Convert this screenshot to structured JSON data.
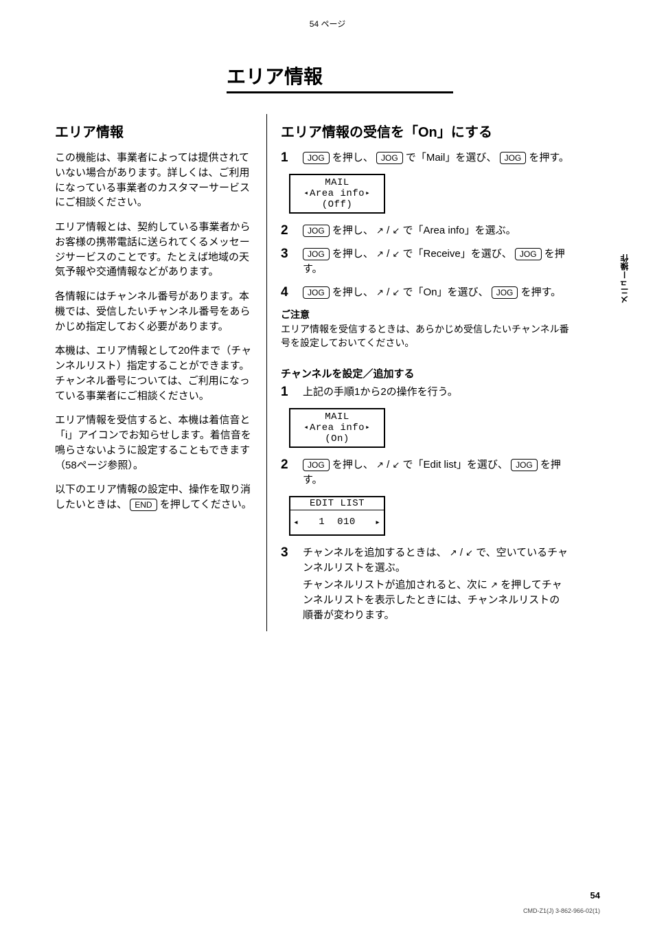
{
  "topPageMarker": "54 ページ",
  "title": "エリア情報",
  "section": {
    "leftHeading": "エリア情報",
    "intro1": "この機能は、事業者によっては提供されていない場合があります。詳しくは、ご利用になっている事業者のカスタマーサービスにご相談ください。",
    "intro2": "エリア情報とは、契約している事業者からお客様の携帯電話に送られてくるメッセージサービスのことです。たとえば地域の天気予報や交通情報などがあります。",
    "intro3": "各情報にはチャンネル番号があります。本機では、受信したいチャンネル番号をあらかじめ指定しておく必要があります。",
    "intro4": "本機は、エリア情報として20件まで（チャンネルリスト）指定することができます。チャンネル番号については、ご利用になっている事業者にご相談ください。",
    "intro5": "エリア情報を受信すると、本機は着信音と「i」アイコンでお知らせします。着信音を鳴らさないように設定することもできます（58ページ参照）。",
    "cancelNote": "以下のエリア情報の設定中、操作を取り消したいときは、",
    "cancelNote2": "を押してください。"
  },
  "right": {
    "heading": "エリア情報の受信を「On」にする",
    "step1_lead": "を押し、",
    "step1_lead2": "で「Mail」を選び、",
    "step1_lead3": "を押す。",
    "step2_a": "を押し、",
    "step2_b": "/",
    "step2_c": "で「Area info」を選ぶ。",
    "step3_a": "を押し、",
    "step3_b": "/",
    "step3_c": "で「Receive」を選び、",
    "step3_d": "を押す。",
    "step4_a": "を押し、",
    "step4_b": "/",
    "step4_c": "で「On」を選び、",
    "step4_d": "を押す。",
    "noteTitle": "ご注意",
    "noteBody": "エリア情報を受信するときは、あらかじめ受信したいチャンネル番号を設定しておいてください。",
    "sub2": "チャンネルを設定／追加する",
    "sub2_p1a": "上記の手順1から2の操作を行う。",
    "sub2_2a": "を押し、",
    "sub2_2b": "/",
    "sub2_2c": "で「Edit list」を選び、",
    "sub2_2d": "を押す。",
    "sub2_3a": "チャンネルを追加するときは、",
    "sub2_3b": "/",
    "sub2_3c": "で、空いているチャンネルリストを選ぶ。",
    "sub2_3d": "チャンネルリストが追加されると、次に",
    "sub2_3e": "を押してチャンネルリストを表示したときには、チャンネルリストの順番が変わります。"
  },
  "lcd1": {
    "l1": "MAIL",
    "l2": "Area info",
    "l3": "(Off)"
  },
  "lcd2": {
    "l1": "MAIL",
    "l2": "Area info",
    "l3": "(On)"
  },
  "lcd3": {
    "title": "EDIT LIST",
    "idx": "1",
    "val": "010"
  },
  "jogLabel": "JOG",
  "vertical": "メニュー操作",
  "footerNum": "54",
  "footerCode": "CMD-Z1(J) 3-862-966-02(1)"
}
